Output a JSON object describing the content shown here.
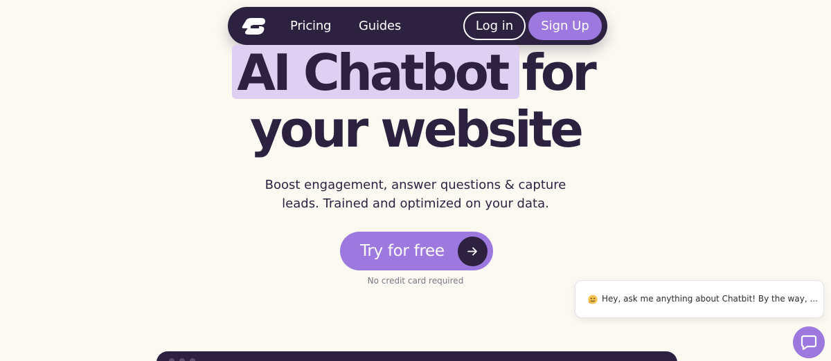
{
  "nav": {
    "logo_icon": "chatbit-logo-icon",
    "links": [
      {
        "label": "Pricing"
      },
      {
        "label": "Guides"
      }
    ],
    "login_label": "Log in",
    "signup_label": "Sign Up"
  },
  "hero": {
    "headline_highlight": "AI Chatbot",
    "headline_rest_line1": "for",
    "headline_line2": "your website",
    "subtitle_line1": "Boost engagement, answer questions & capture",
    "subtitle_line2": "leads. Trained and optimized on your data.",
    "cta_label": "Try for free",
    "cta_icon": "arrow-right-icon",
    "cta_note": "No credit card required"
  },
  "chat_widget": {
    "emoji_icon": "waving-face-emoji-icon",
    "greeting": "Hey, ask me anything about Chatbit! By the way, ...",
    "launcher_icon": "chat-bubble-icon"
  },
  "colors": {
    "background": "#fcf9f2",
    "dark": "#2c2240",
    "accent": "#9d78de",
    "highlight": "#ddd0f3"
  }
}
